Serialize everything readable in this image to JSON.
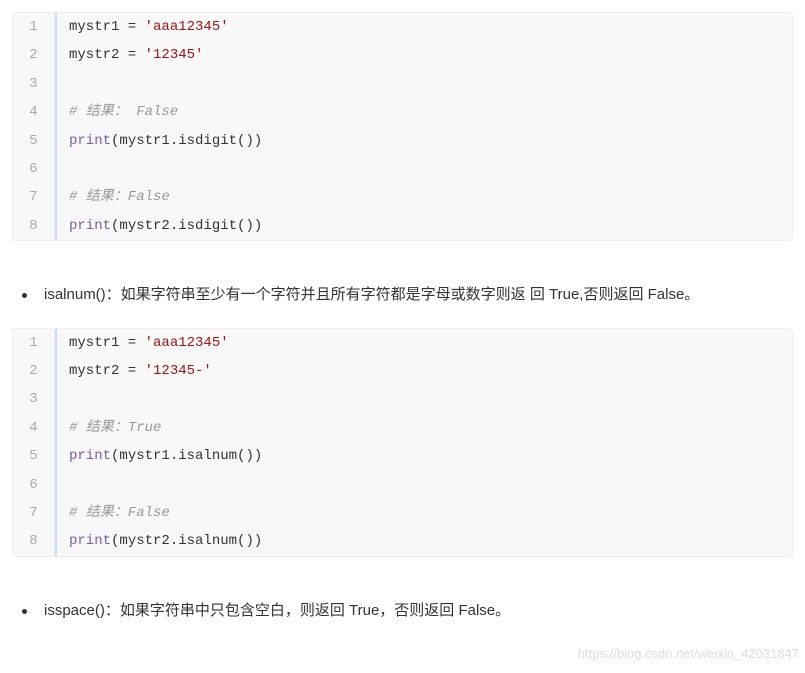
{
  "code1": {
    "lines": [
      {
        "n": "1",
        "tokens": [
          "mystr1 = ",
          {
            "t": "str",
            "v": "'aaa12345'"
          }
        ]
      },
      {
        "n": "2",
        "tokens": [
          "mystr2 = ",
          {
            "t": "str",
            "v": "'12345'"
          }
        ]
      },
      {
        "n": "3",
        "tokens": [
          ""
        ]
      },
      {
        "n": "4",
        "tokens": [
          {
            "t": "com",
            "v": "# 结果： False"
          }
        ]
      },
      {
        "n": "5",
        "tokens": [
          {
            "t": "fn",
            "v": "print"
          },
          "(mystr1.isdigit())"
        ]
      },
      {
        "n": "6",
        "tokens": [
          ""
        ]
      },
      {
        "n": "7",
        "tokens": [
          {
            "t": "com",
            "v": "# 结果：False"
          }
        ]
      },
      {
        "n": "8",
        "tokens": [
          {
            "t": "fn",
            "v": "print"
          },
          "(mystr2.isdigit())"
        ]
      }
    ]
  },
  "bullet1": "isalnum()：如果字符串至少有一个字符并且所有字符都是字母或数字则返 回 True,否则返回 False。",
  "code2": {
    "lines": [
      {
        "n": "1",
        "tokens": [
          "mystr1 = ",
          {
            "t": "str",
            "v": "'aaa12345'"
          }
        ]
      },
      {
        "n": "2",
        "tokens": [
          "mystr2 = ",
          {
            "t": "str",
            "v": "'12345-'"
          }
        ]
      },
      {
        "n": "3",
        "tokens": [
          ""
        ]
      },
      {
        "n": "4",
        "tokens": [
          {
            "t": "com",
            "v": "# 结果：True"
          }
        ]
      },
      {
        "n": "5",
        "tokens": [
          {
            "t": "fn",
            "v": "print"
          },
          "(mystr1.isalnum())"
        ]
      },
      {
        "n": "6",
        "tokens": [
          ""
        ]
      },
      {
        "n": "7",
        "tokens": [
          {
            "t": "com",
            "v": "# 结果：False"
          }
        ]
      },
      {
        "n": "8",
        "tokens": [
          {
            "t": "fn",
            "v": "print"
          },
          "(mystr2.isalnum())"
        ]
      }
    ]
  },
  "bullet2": "isspace()：如果字符串中只包含空白，则返回 True，否则返回 False。",
  "watermark": "https://blog.csdn.net/weixin_42031847"
}
